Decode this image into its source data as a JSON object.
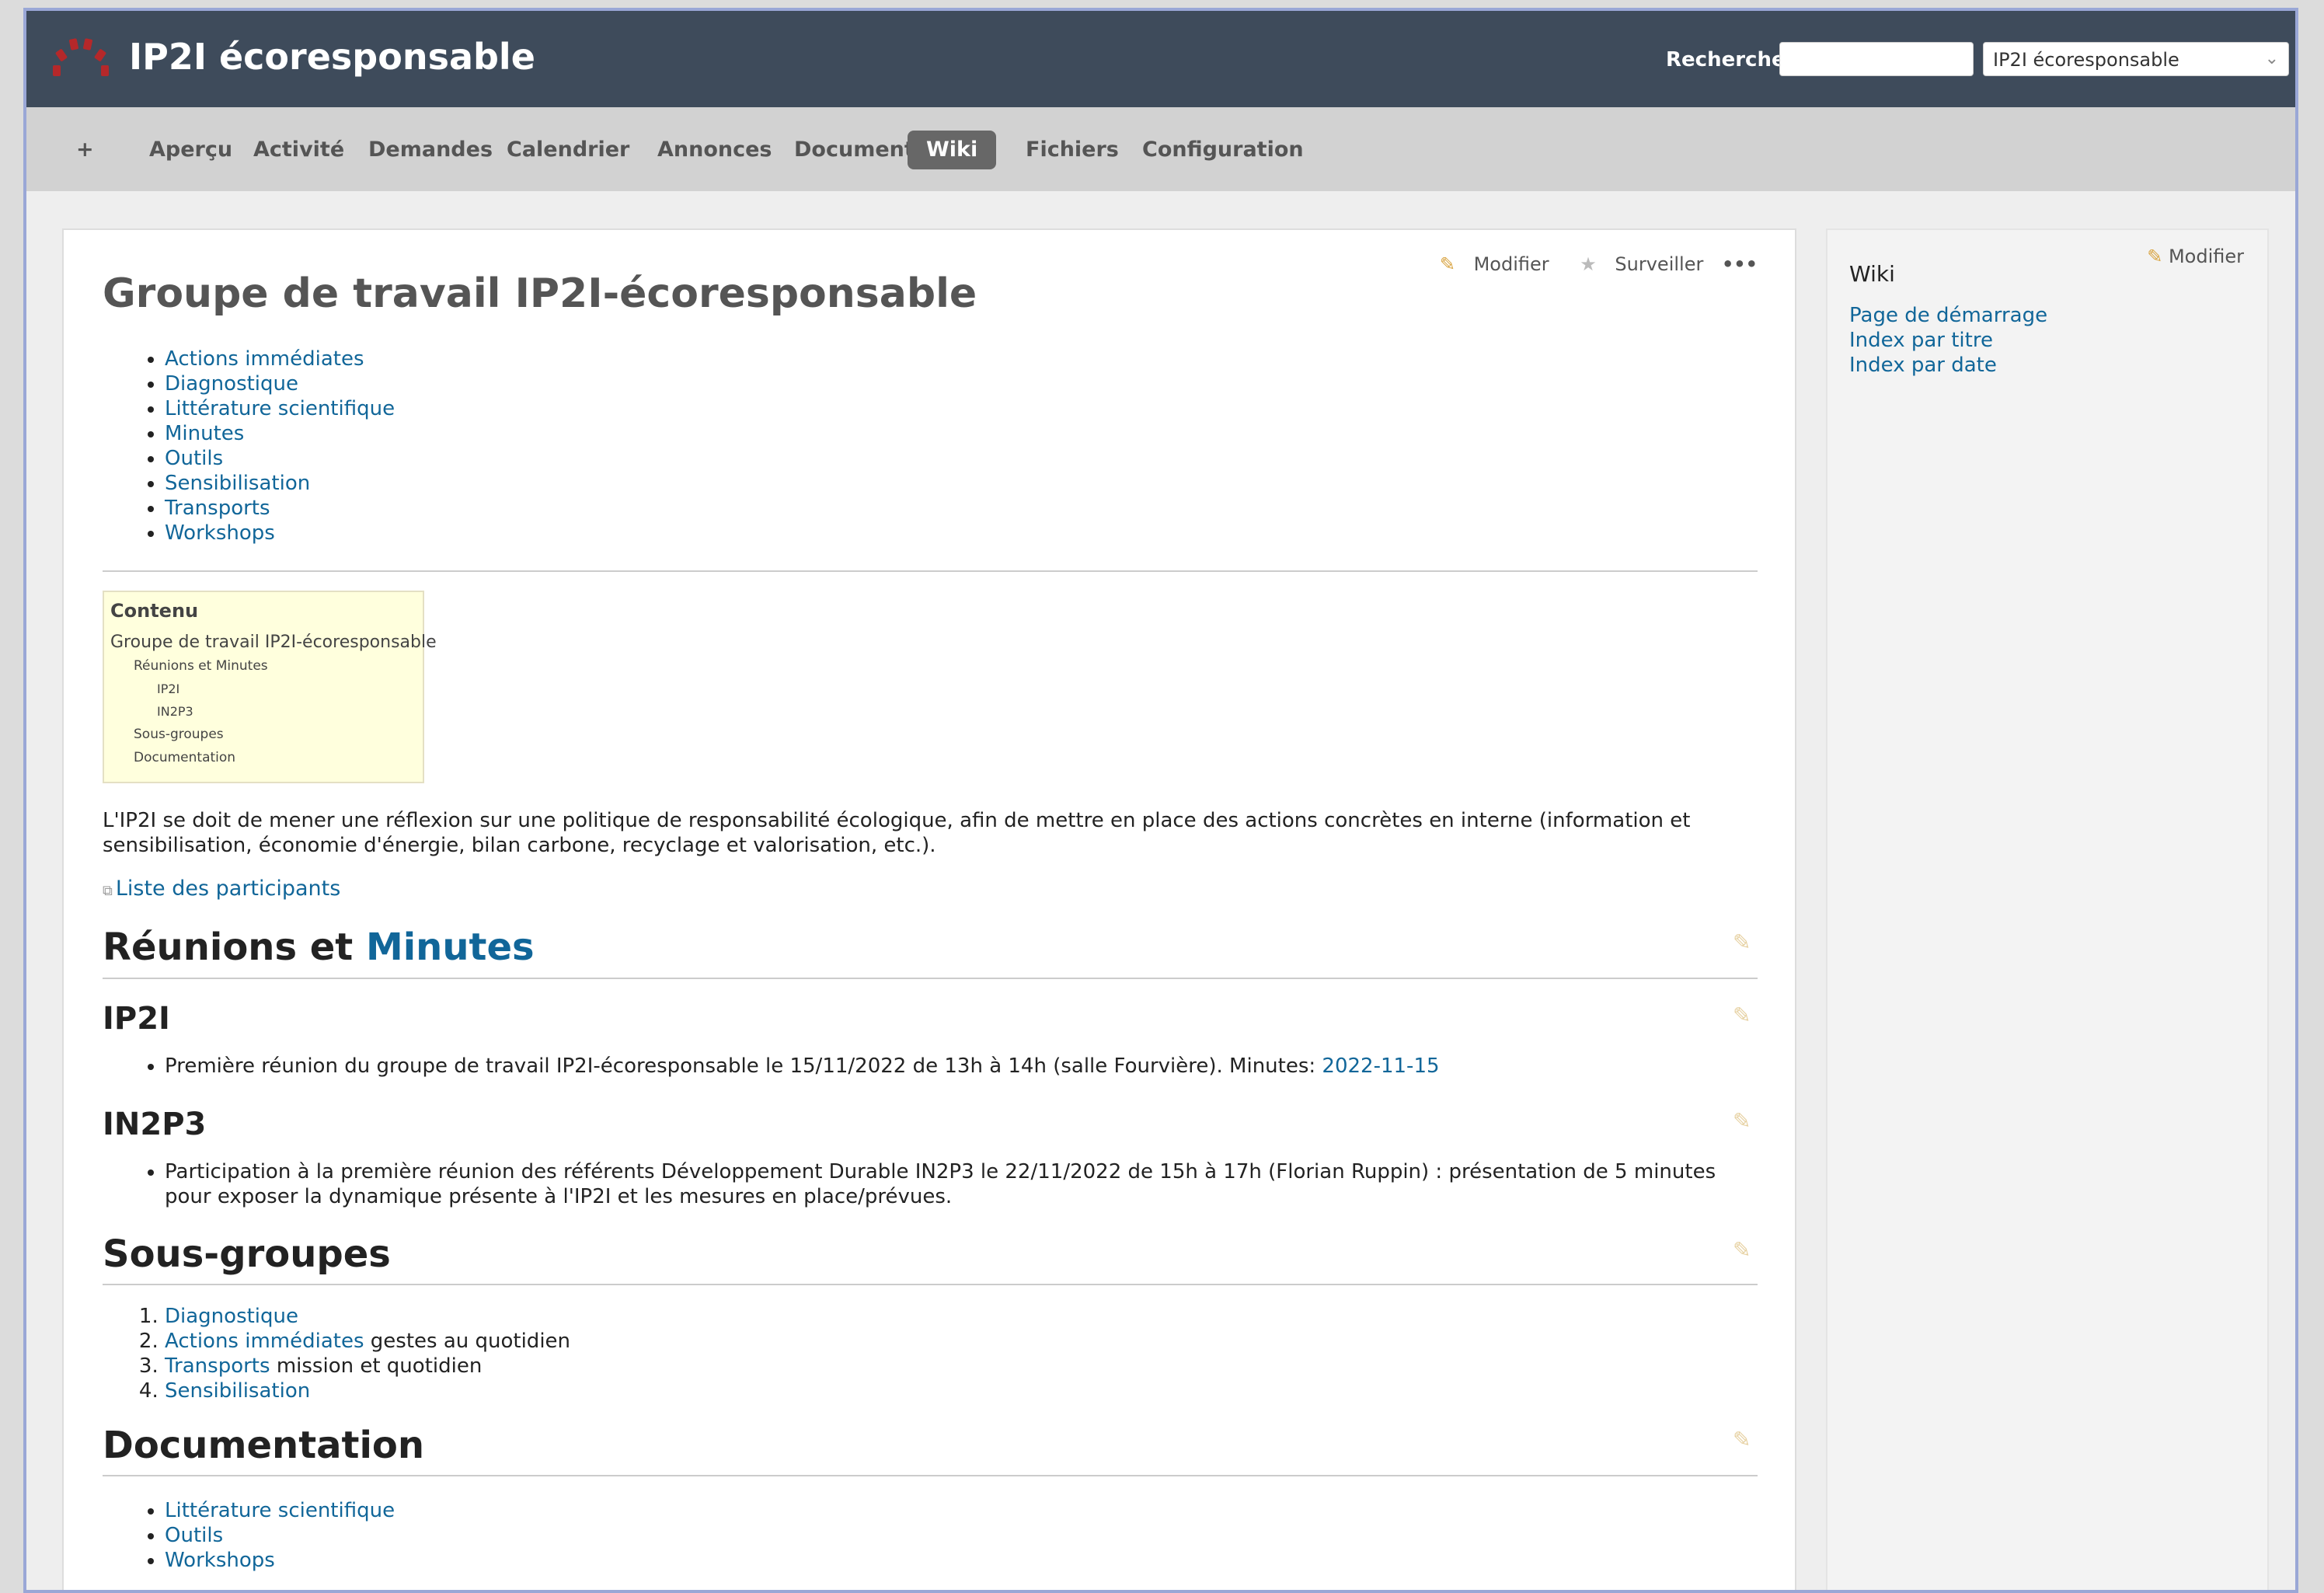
{
  "header": {
    "title": "IP2I écoresponsable",
    "search_label": "Recherche:",
    "project_selected": "IP2I écoresponsable"
  },
  "menu": {
    "new": "+",
    "items": [
      "Aperçu",
      "Activité",
      "Demandes",
      "Calendrier",
      "Annonces",
      "Documents",
      "Wiki",
      "Fichiers",
      "Configuration"
    ],
    "active": "Wiki"
  },
  "contextual": {
    "edit": "Modifier",
    "watch": "Surveiller",
    "more": "•••"
  },
  "page": {
    "title": "Groupe de travail IP2I-écoresponsable",
    "top_links": [
      "Actions immédiates",
      "Diagnostique",
      "Littérature scientifique",
      "Minutes",
      "Outils",
      "Sensibilisation",
      "Transports",
      "Workshops"
    ],
    "toc": {
      "title": "Contenu",
      "items": [
        "Groupe de travail IP2I-écoresponsable",
        "Réunions et Minutes",
        "IP2I",
        "IN2P3",
        "Sous-groupes",
        "Documentation"
      ]
    },
    "intro": "L'IP2I se doit de mener une réflexion sur une politique de responsabilité écologique, afin de mettre en place des actions concrètes en interne (information et sensibilisation, économie d'énergie, bilan carbone, recyclage et valorisation, etc.).",
    "participants_link": "Liste des participants",
    "reunions": {
      "title_text": "Réunions et ",
      "title_link": "Minutes"
    },
    "ip2i": {
      "title": "IP2I",
      "item_text": "Première réunion du groupe de travail IP2I-écoresponsable le 15/11/2022 de 13h à 14h (salle Fourvière). Minutes: ",
      "item_link": "2022-11-15"
    },
    "in2p3": {
      "title": "IN2P3",
      "item_text": "Participation à la première réunion des référents Développement Durable IN2P3 le 22/11/2022 de 15h à 17h (Florian Ruppin) : présentation de 5 minutes pour exposer la dynamique présente à l'IP2I et les mesures en place/prévues."
    },
    "sous_groupes": {
      "title": "Sous-groupes",
      "items": [
        {
          "link": "Diagnostique",
          "text": ""
        },
        {
          "link": "Actions immédiates",
          "text": " gestes au quotidien"
        },
        {
          "link": "Transports",
          "text": " mission et quotidien"
        },
        {
          "link": "Sensibilisation",
          "text": ""
        }
      ]
    },
    "documentation": {
      "title": "Documentation",
      "items": [
        "Littérature scientifique",
        "Outils",
        "Workshops"
      ]
    }
  },
  "sidebar": {
    "edit": "Modifier",
    "title": "Wiki",
    "links": [
      "Page de démarrage",
      "Index par titre",
      "Index par date"
    ]
  },
  "colors": {
    "header_bg": "#3e4b5b",
    "menu_bg": "#d2d2d2",
    "link": "#116699",
    "toc_bg": "#ffffdd",
    "logo_red": "#b5282a"
  }
}
